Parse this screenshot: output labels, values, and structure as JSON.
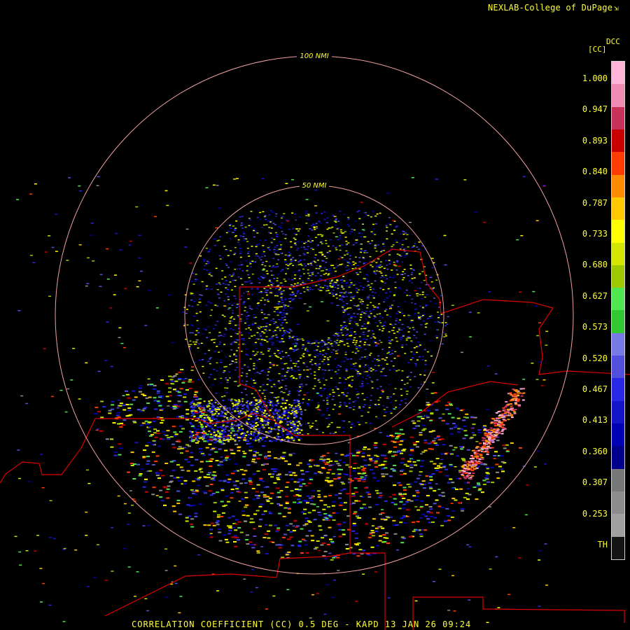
{
  "header": {
    "credit": "NEXLAB-College of DuPage",
    "credit_icon": "logo-arrow-icon"
  },
  "legend": {
    "product_code": "DCC",
    "unit": "[CC]",
    "ticks": [
      "1.000",
      "0.947",
      "0.893",
      "0.840",
      "0.787",
      "0.733",
      "0.680",
      "0.627",
      "0.573",
      "0.520",
      "0.467",
      "0.413",
      "0.360",
      "0.307",
      "0.253",
      "TH"
    ],
    "color_stops": [
      "#ffb6d6",
      "#f08cb4",
      "#c8325a",
      "#c80000",
      "#ff3c00",
      "#ff8c00",
      "#ffc800",
      "#ffff00",
      "#d2e600",
      "#a0c800",
      "#50e650",
      "#32c832",
      "#7878e6",
      "#5050dc",
      "#2828e6",
      "#1414c8",
      "#0000b4",
      "#00008c",
      "#787878",
      "#8c8c8c",
      "#a0a0a0",
      "#141414"
    ]
  },
  "rings": {
    "inner_label": "50 NMI",
    "outer_label": "100 NMI"
  },
  "footer": {
    "caption": "CORRELATION COEFFICIENT (CC) 0.5 DEG - KAPD 13 JAN 26 09:24"
  },
  "colors": {
    "ring": "#f0a0a0",
    "boundary": "#dd0000",
    "label": "#ffff33"
  }
}
